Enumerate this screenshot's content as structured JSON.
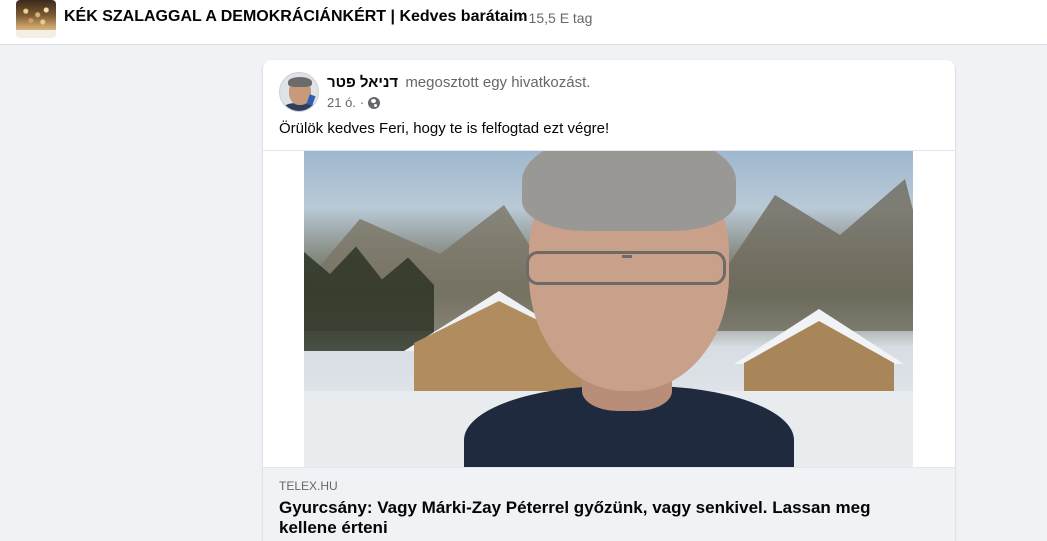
{
  "group": {
    "title": "KÉK SZALAGGAL A DEMOKRÁCIÁNKÉRT | Kedves barátaim",
    "members": "· 15,5 E tag"
  },
  "post": {
    "author": "דניאל פטר",
    "action": "megosztott egy hivatkozást.",
    "time": "21 ó.",
    "separator": "·",
    "privacy_icon": "globe-icon",
    "text": "Örülök kedves Feri, hogy te is felfogtad ezt végre!"
  },
  "link_preview": {
    "domain": "TELEX.HU",
    "title": "Gyurcsány: Vagy Márki-Zay Péterrel győzünk, vagy senkivel. Lassan meg kellene érteni"
  }
}
